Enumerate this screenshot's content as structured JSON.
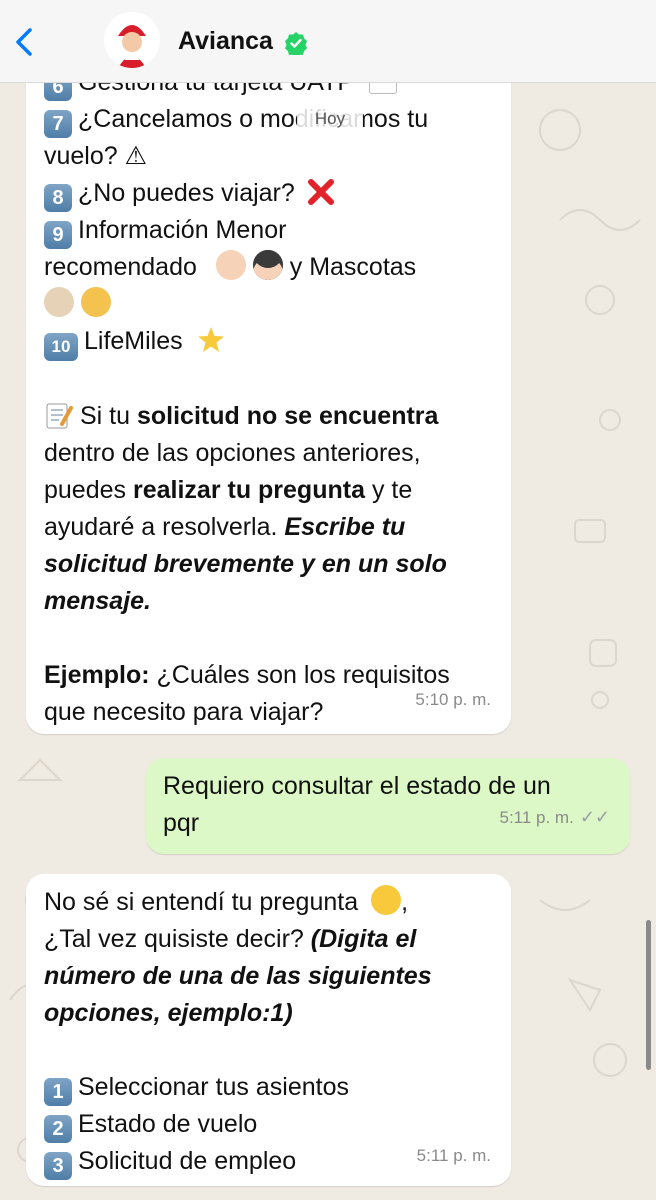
{
  "header": {
    "contact_name": "Avianca",
    "avatar_badge_text": "Avianca"
  },
  "date_pill": "Hoy",
  "messages": [
    {
      "direction": "in",
      "lines": [
        {
          "n": "6",
          "text": "Gestiona tu tarjeta UATP"
        },
        {
          "n": "7",
          "text": "¿Cancelamos o modificamos tu"
        },
        {
          "text": "vuelo? ⚠"
        },
        {
          "n": "8",
          "text": "¿No puedes viajar?"
        },
        {
          "n": "9",
          "text": "Información Menor"
        },
        {
          "text": "recomendado"
        },
        {
          "text_after_faces": "y Mascotas"
        },
        {
          "n": "10",
          "text": "LifeMiles"
        },
        {
          "pre": "Si tu",
          "bold": "solicitud no se encuentra"
        },
        {
          "text": "dentro de las opciones anteriores,"
        },
        {
          "pre": "puedes",
          "bold": "realizar tu pregunta",
          "post": "y te"
        },
        {
          "pre": "ayudaré a resolverla.",
          "bi": "Escribe tu"
        },
        {
          "bi": "solicitud brevemente y en un solo"
        },
        {
          "bi": "mensaje."
        },
        {
          "bold": "Ejemplo:",
          "post": "¿Cuáles son los requisitos"
        },
        {
          "text": "que necesito para viajar?"
        }
      ],
      "time": "5:10 p. m."
    },
    {
      "direction": "out",
      "lines": [
        {
          "text": "Requiero consultar el estado de un"
        },
        {
          "text": "pqr"
        }
      ],
      "time": "5:11 p. m."
    },
    {
      "direction": "in",
      "lines": [
        {
          "text": "No sé si entendí tu pregunta"
        },
        {
          "pre": "¿Tal vez quisiste decir?",
          "bi": "(Digita el"
        },
        {
          "bi": "número de una de las siguientes"
        },
        {
          "bi": "opciones, ejemplo:1)"
        },
        {
          "n": "1",
          "text": "Seleccionar tus asientos"
        },
        {
          "n": "2",
          "text": "Estado de vuelo"
        },
        {
          "n": "3",
          "text": "Solicitud de empleo"
        }
      ],
      "time": "5:11 p. m."
    }
  ],
  "colors": {
    "wallpaper": "#efeae2",
    "incoming_bubble": "#ffffff",
    "outgoing_bubble": "#dcf8c6",
    "header": "#f6f6f6",
    "accent": "#007aff"
  }
}
